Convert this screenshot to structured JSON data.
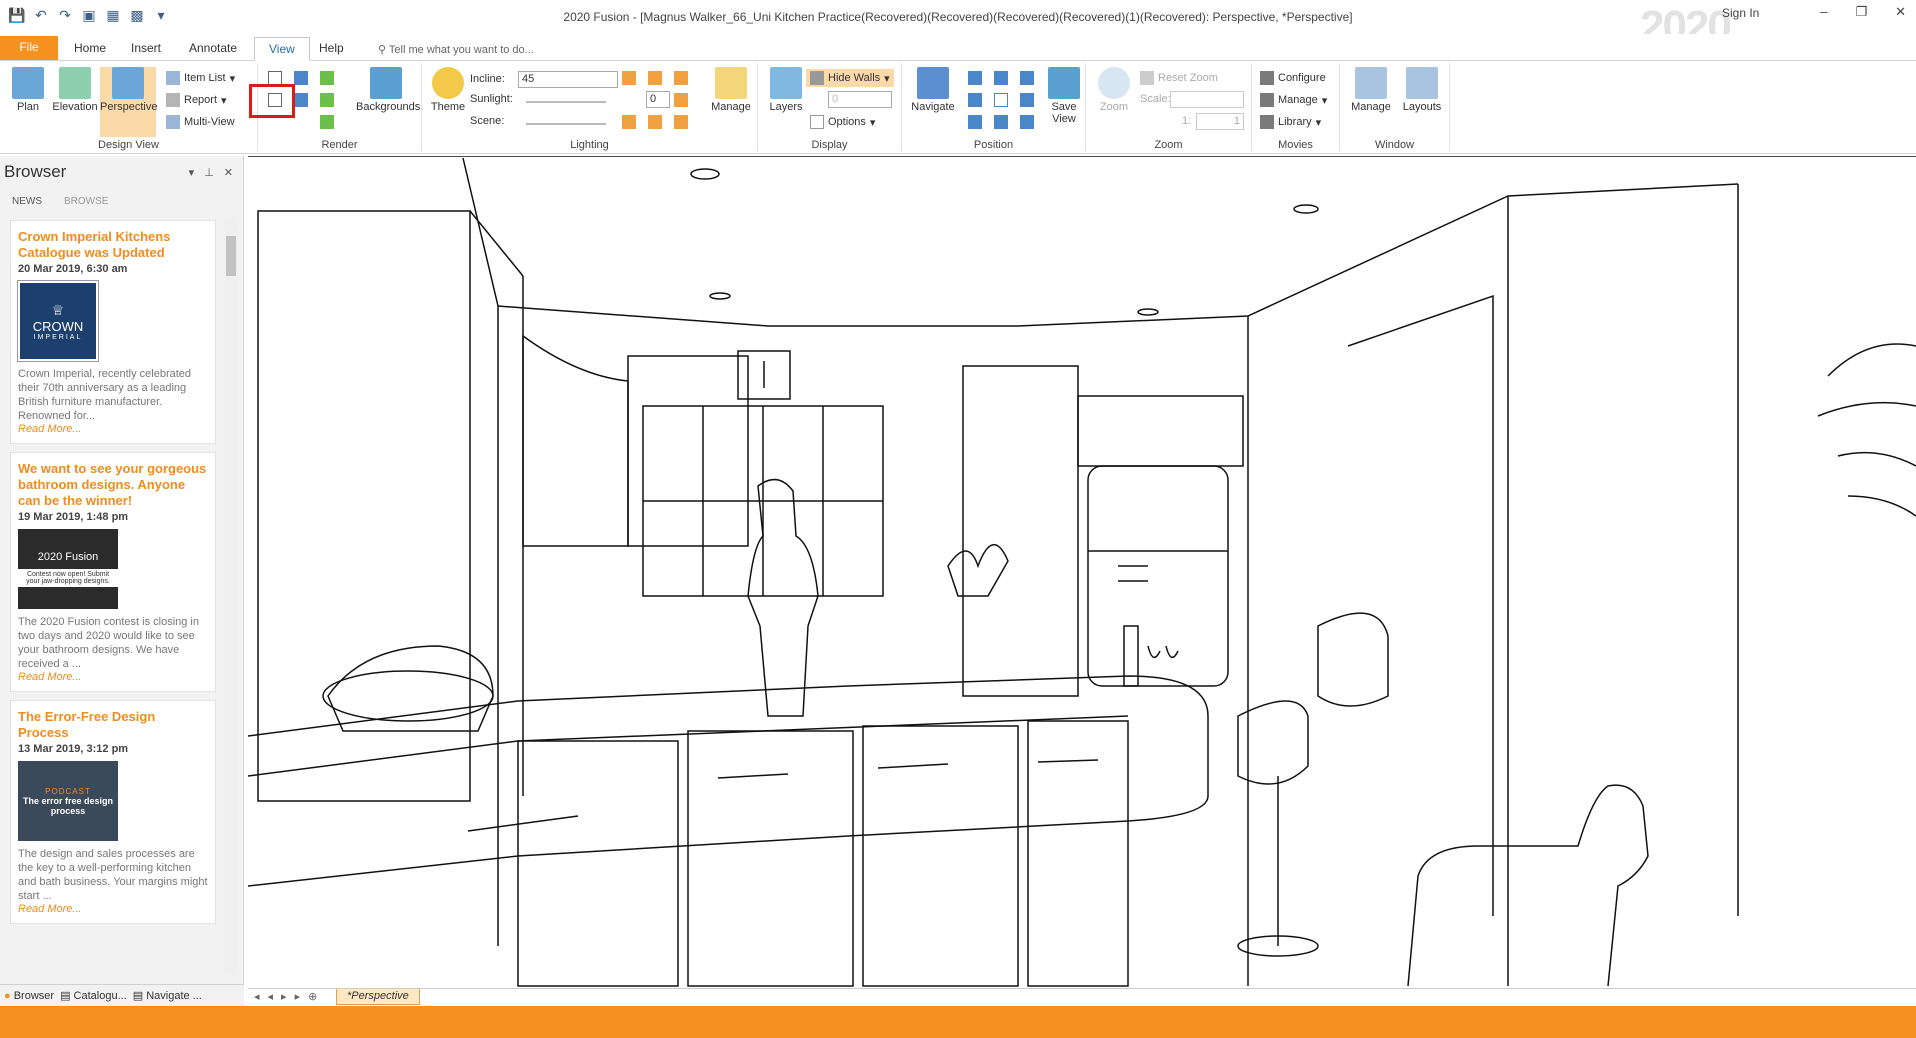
{
  "window": {
    "title": "2020 Fusion - [Magnus Walker_66_Uni Kitchen Practice(Recovered)(Recovered)(Recovered)(Recovered)(1)(Recovered): Perspective, *Perspective]",
    "logo": "2020",
    "signin": "Sign In",
    "minimize": "–",
    "restore": "❐",
    "close": "✕"
  },
  "tabs": [
    {
      "label": "File"
    },
    {
      "label": "Home"
    },
    {
      "label": "Insert"
    },
    {
      "label": "Annotate"
    },
    {
      "label": "View"
    },
    {
      "label": "Help"
    }
  ],
  "tell_me": "Tell me what you want to do...",
  "ribbon": {
    "design_view": {
      "label": "Design View",
      "plan": "Plan",
      "elevation": "Elevation",
      "perspective": "Perspective",
      "item_list": "Item List",
      "report": "Report",
      "multi_view": "Multi-View"
    },
    "render": {
      "label": "Render",
      "backgrounds": "Backgrounds"
    },
    "lighting": {
      "label": "Lighting",
      "theme": "Theme",
      "incline_label": "Incline:",
      "incline_value": "45",
      "sunlight_label": "Sunlight:",
      "sunlight_value": "0",
      "scene_label": "Scene:",
      "manage": "Manage"
    },
    "display": {
      "label": "Display",
      "layers": "Layers",
      "hide_walls": "Hide Walls",
      "hide_walls_value": "0",
      "options": "Options"
    },
    "position": {
      "label": "Position",
      "navigate": "Navigate",
      "save_view": "Save View"
    },
    "zoom": {
      "label": "Zoom",
      "zoom": "Zoom",
      "reset_zoom": "Reset Zoom",
      "scale_label": "Scale:",
      "ratio_left": "1:",
      "ratio_value": "1"
    },
    "movies": {
      "label": "Movies",
      "configure": "Configure",
      "manage": "Manage",
      "library": "Library"
    },
    "window": {
      "label": "Window",
      "manage": "Manage",
      "layouts": "Layouts"
    }
  },
  "browser": {
    "title": "Browser",
    "tabs": [
      "NEWS",
      "BROWSE"
    ],
    "cards": [
      {
        "title": "Crown Imperial Kitchens Catalogue was Updated",
        "date": "20 Mar 2019, 6:30 am",
        "thumb_line1": "CROWN",
        "thumb_line2": "IMPERIAL",
        "text": "Crown Imperial, recently celebrated their 70th anniversary as a leading British furniture manufacturer. Renowned for...",
        "more": "Read More..."
      },
      {
        "title": "We want to see your gorgeous bathroom designs. Anyone can be the winner!",
        "date": "19 Mar 2019, 1:48 pm",
        "thumb_line1": "2020 Fusion",
        "thumb_line2": "Contest now open! Submit your jaw-dropping designs.",
        "text": "The 2020 Fusion contest is closing in two days and 2020 would like to see your bathroom designs. We have received a ...",
        "more": "Read More..."
      },
      {
        "title": "The Error-Free Design Process",
        "date": "13 Mar 2019, 3:12 pm",
        "thumb_line1": "PODCAST",
        "thumb_line2": "The error free design process",
        "text": "The design and sales processes are the key to a well-performing kitchen and bath business. Your margins might start ...",
        "more": "Read More..."
      }
    ],
    "bottom_tabs": [
      "Browser",
      "Catalogu...",
      "Navigate ..."
    ]
  },
  "viewport": {
    "tab": "*Perspective"
  },
  "colors": {
    "accent": "#f5911e",
    "title_orange": "#f28c1b",
    "highlight": "#e01818"
  }
}
